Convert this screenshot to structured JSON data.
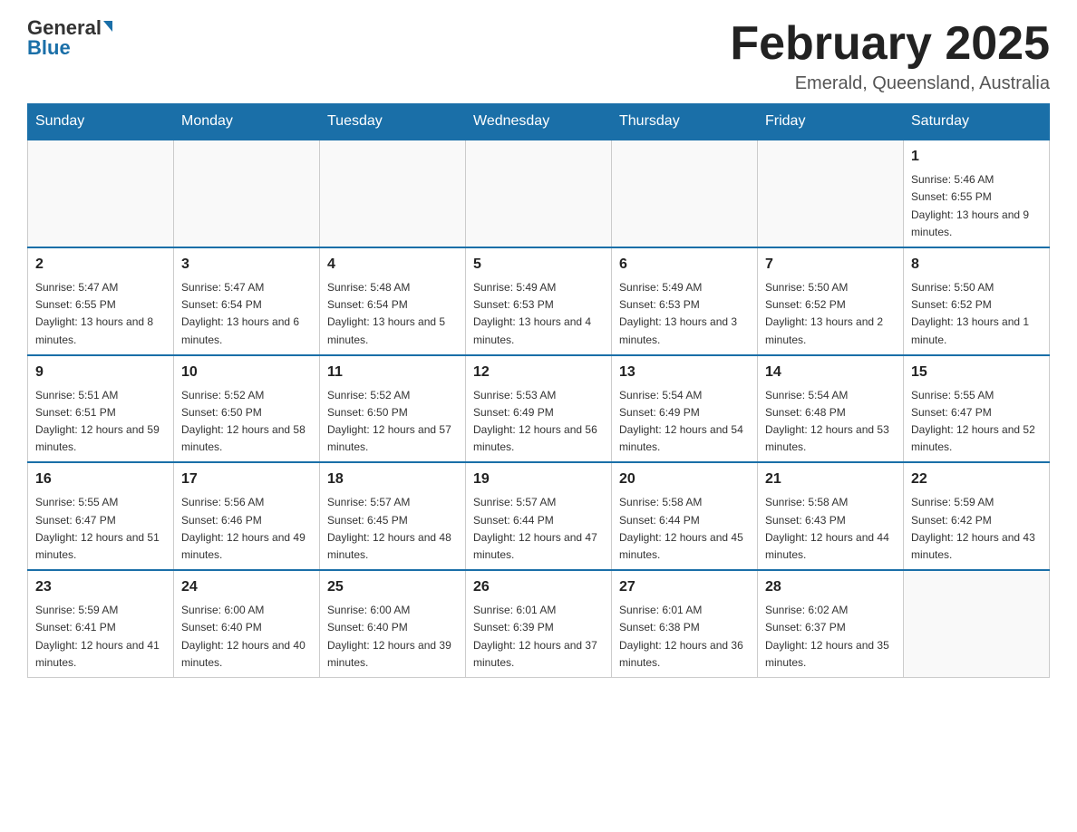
{
  "logo": {
    "general": "General",
    "blue": "Blue"
  },
  "header": {
    "title": "February 2025",
    "location": "Emerald, Queensland, Australia"
  },
  "weekdays": [
    "Sunday",
    "Monday",
    "Tuesday",
    "Wednesday",
    "Thursday",
    "Friday",
    "Saturday"
  ],
  "weeks": [
    [
      {
        "day": "",
        "info": ""
      },
      {
        "day": "",
        "info": ""
      },
      {
        "day": "",
        "info": ""
      },
      {
        "day": "",
        "info": ""
      },
      {
        "day": "",
        "info": ""
      },
      {
        "day": "",
        "info": ""
      },
      {
        "day": "1",
        "info": "Sunrise: 5:46 AM\nSunset: 6:55 PM\nDaylight: 13 hours and 9 minutes."
      }
    ],
    [
      {
        "day": "2",
        "info": "Sunrise: 5:47 AM\nSunset: 6:55 PM\nDaylight: 13 hours and 8 minutes."
      },
      {
        "day": "3",
        "info": "Sunrise: 5:47 AM\nSunset: 6:54 PM\nDaylight: 13 hours and 6 minutes."
      },
      {
        "day": "4",
        "info": "Sunrise: 5:48 AM\nSunset: 6:54 PM\nDaylight: 13 hours and 5 minutes."
      },
      {
        "day": "5",
        "info": "Sunrise: 5:49 AM\nSunset: 6:53 PM\nDaylight: 13 hours and 4 minutes."
      },
      {
        "day": "6",
        "info": "Sunrise: 5:49 AM\nSunset: 6:53 PM\nDaylight: 13 hours and 3 minutes."
      },
      {
        "day": "7",
        "info": "Sunrise: 5:50 AM\nSunset: 6:52 PM\nDaylight: 13 hours and 2 minutes."
      },
      {
        "day": "8",
        "info": "Sunrise: 5:50 AM\nSunset: 6:52 PM\nDaylight: 13 hours and 1 minute."
      }
    ],
    [
      {
        "day": "9",
        "info": "Sunrise: 5:51 AM\nSunset: 6:51 PM\nDaylight: 12 hours and 59 minutes."
      },
      {
        "day": "10",
        "info": "Sunrise: 5:52 AM\nSunset: 6:50 PM\nDaylight: 12 hours and 58 minutes."
      },
      {
        "day": "11",
        "info": "Sunrise: 5:52 AM\nSunset: 6:50 PM\nDaylight: 12 hours and 57 minutes."
      },
      {
        "day": "12",
        "info": "Sunrise: 5:53 AM\nSunset: 6:49 PM\nDaylight: 12 hours and 56 minutes."
      },
      {
        "day": "13",
        "info": "Sunrise: 5:54 AM\nSunset: 6:49 PM\nDaylight: 12 hours and 54 minutes."
      },
      {
        "day": "14",
        "info": "Sunrise: 5:54 AM\nSunset: 6:48 PM\nDaylight: 12 hours and 53 minutes."
      },
      {
        "day": "15",
        "info": "Sunrise: 5:55 AM\nSunset: 6:47 PM\nDaylight: 12 hours and 52 minutes."
      }
    ],
    [
      {
        "day": "16",
        "info": "Sunrise: 5:55 AM\nSunset: 6:47 PM\nDaylight: 12 hours and 51 minutes."
      },
      {
        "day": "17",
        "info": "Sunrise: 5:56 AM\nSunset: 6:46 PM\nDaylight: 12 hours and 49 minutes."
      },
      {
        "day": "18",
        "info": "Sunrise: 5:57 AM\nSunset: 6:45 PM\nDaylight: 12 hours and 48 minutes."
      },
      {
        "day": "19",
        "info": "Sunrise: 5:57 AM\nSunset: 6:44 PM\nDaylight: 12 hours and 47 minutes."
      },
      {
        "day": "20",
        "info": "Sunrise: 5:58 AM\nSunset: 6:44 PM\nDaylight: 12 hours and 45 minutes."
      },
      {
        "day": "21",
        "info": "Sunrise: 5:58 AM\nSunset: 6:43 PM\nDaylight: 12 hours and 44 minutes."
      },
      {
        "day": "22",
        "info": "Sunrise: 5:59 AM\nSunset: 6:42 PM\nDaylight: 12 hours and 43 minutes."
      }
    ],
    [
      {
        "day": "23",
        "info": "Sunrise: 5:59 AM\nSunset: 6:41 PM\nDaylight: 12 hours and 41 minutes."
      },
      {
        "day": "24",
        "info": "Sunrise: 6:00 AM\nSunset: 6:40 PM\nDaylight: 12 hours and 40 minutes."
      },
      {
        "day": "25",
        "info": "Sunrise: 6:00 AM\nSunset: 6:40 PM\nDaylight: 12 hours and 39 minutes."
      },
      {
        "day": "26",
        "info": "Sunrise: 6:01 AM\nSunset: 6:39 PM\nDaylight: 12 hours and 37 minutes."
      },
      {
        "day": "27",
        "info": "Sunrise: 6:01 AM\nSunset: 6:38 PM\nDaylight: 12 hours and 36 minutes."
      },
      {
        "day": "28",
        "info": "Sunrise: 6:02 AM\nSunset: 6:37 PM\nDaylight: 12 hours and 35 minutes."
      },
      {
        "day": "",
        "info": ""
      }
    ]
  ]
}
